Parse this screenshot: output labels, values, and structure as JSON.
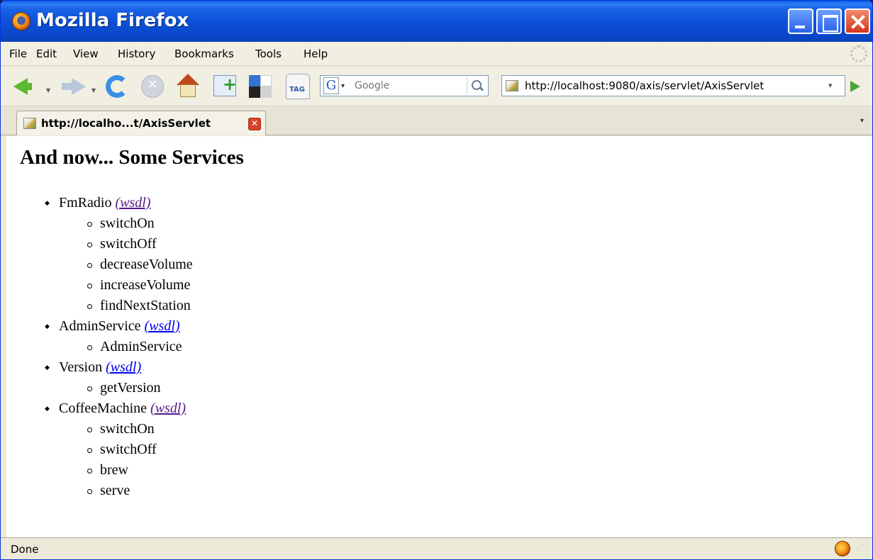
{
  "window": {
    "title": "Mozilla Firefox"
  },
  "menu": {
    "items": [
      "File",
      "Edit",
      "View",
      "History",
      "Bookmarks",
      "Tools",
      "Help"
    ]
  },
  "toolbar": {
    "icons": [
      "back-icon",
      "forward-icon",
      "reload-icon",
      "stop-icon",
      "home-icon",
      "new-tab-icon",
      "delicious-icon",
      "tag-icon"
    ],
    "search_engine": "G",
    "search_placeholder": "Google",
    "url": "http://localhost:9080/axis/servlet/AxisServlet"
  },
  "tabs": [
    {
      "label": "http://localho...t/AxisServlet",
      "active": true
    }
  ],
  "page": {
    "title": "And now... Some Services",
    "wsdl_label": "(wsdl)",
    "services": [
      {
        "name": "FmRadio",
        "wsdl_visited": true,
        "methods": [
          "switchOn",
          "switchOff",
          "decreaseVolume",
          "increaseVolume",
          "findNextStation"
        ]
      },
      {
        "name": "AdminService",
        "wsdl_visited": false,
        "methods": [
          "AdminService"
        ]
      },
      {
        "name": "Version",
        "wsdl_visited": false,
        "methods": [
          "getVersion"
        ]
      },
      {
        "name": "CoffeeMachine",
        "wsdl_visited": true,
        "methods": [
          "switchOn",
          "switchOff",
          "brew",
          "serve"
        ]
      }
    ]
  },
  "status": {
    "text": "Done"
  },
  "colors": {
    "titlebar": "#0a47c8",
    "link_visited": "#551a8b",
    "link_unvisited": "#0000ee"
  }
}
